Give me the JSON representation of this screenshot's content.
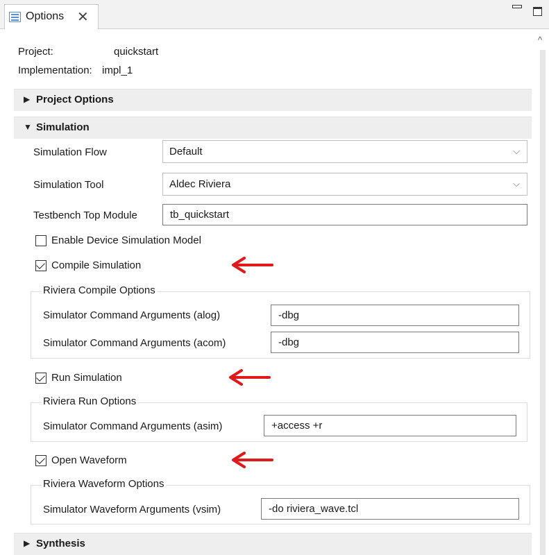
{
  "tab": {
    "title": "Options",
    "close": "✕"
  },
  "header": {
    "project_label": "Project:",
    "project_value": "quickstart",
    "impl_label": "Implementation:",
    "impl_value": "impl_1"
  },
  "sections": {
    "project_options": "Project Options",
    "simulation": "Simulation",
    "synthesis": "Synthesis"
  },
  "simulation": {
    "flow_label": "Simulation Flow",
    "flow_value": "Default",
    "tool_label": "Simulation Tool",
    "tool_value": "Aldec Riviera",
    "tb_label": "Testbench Top Module",
    "tb_value": "tb_quickstart",
    "enable_model_label": "Enable Device Simulation Model",
    "enable_model_checked": false,
    "compile_label": "Compile Simulation",
    "compile_checked": true,
    "compile_group": "Riviera Compile Options",
    "alog_label": "Simulator Command Arguments (alog)",
    "alog_value": "-dbg",
    "acom_label": "Simulator Command Arguments (acom)",
    "acom_value": "-dbg",
    "run_label": "Run Simulation",
    "run_checked": true,
    "run_group": "Riviera Run Options",
    "asim_label": "Simulator Command Arguments (asim)",
    "asim_value": "+access +r",
    "wave_label": "Open Waveform",
    "wave_checked": true,
    "wave_group": "Riviera Waveform Options",
    "vsim_label": "Simulator Waveform Arguments (vsim)",
    "vsim_value": "-do riviera_wave.tcl"
  },
  "icons": {
    "collapsed_arrow": "▶",
    "expanded_arrow": "▼",
    "dropdown_chevron": "⌵",
    "scroll_up": "^"
  },
  "colors": {
    "annotation_arrow": "#e0191b",
    "section_bg": "#eeeeee"
  }
}
